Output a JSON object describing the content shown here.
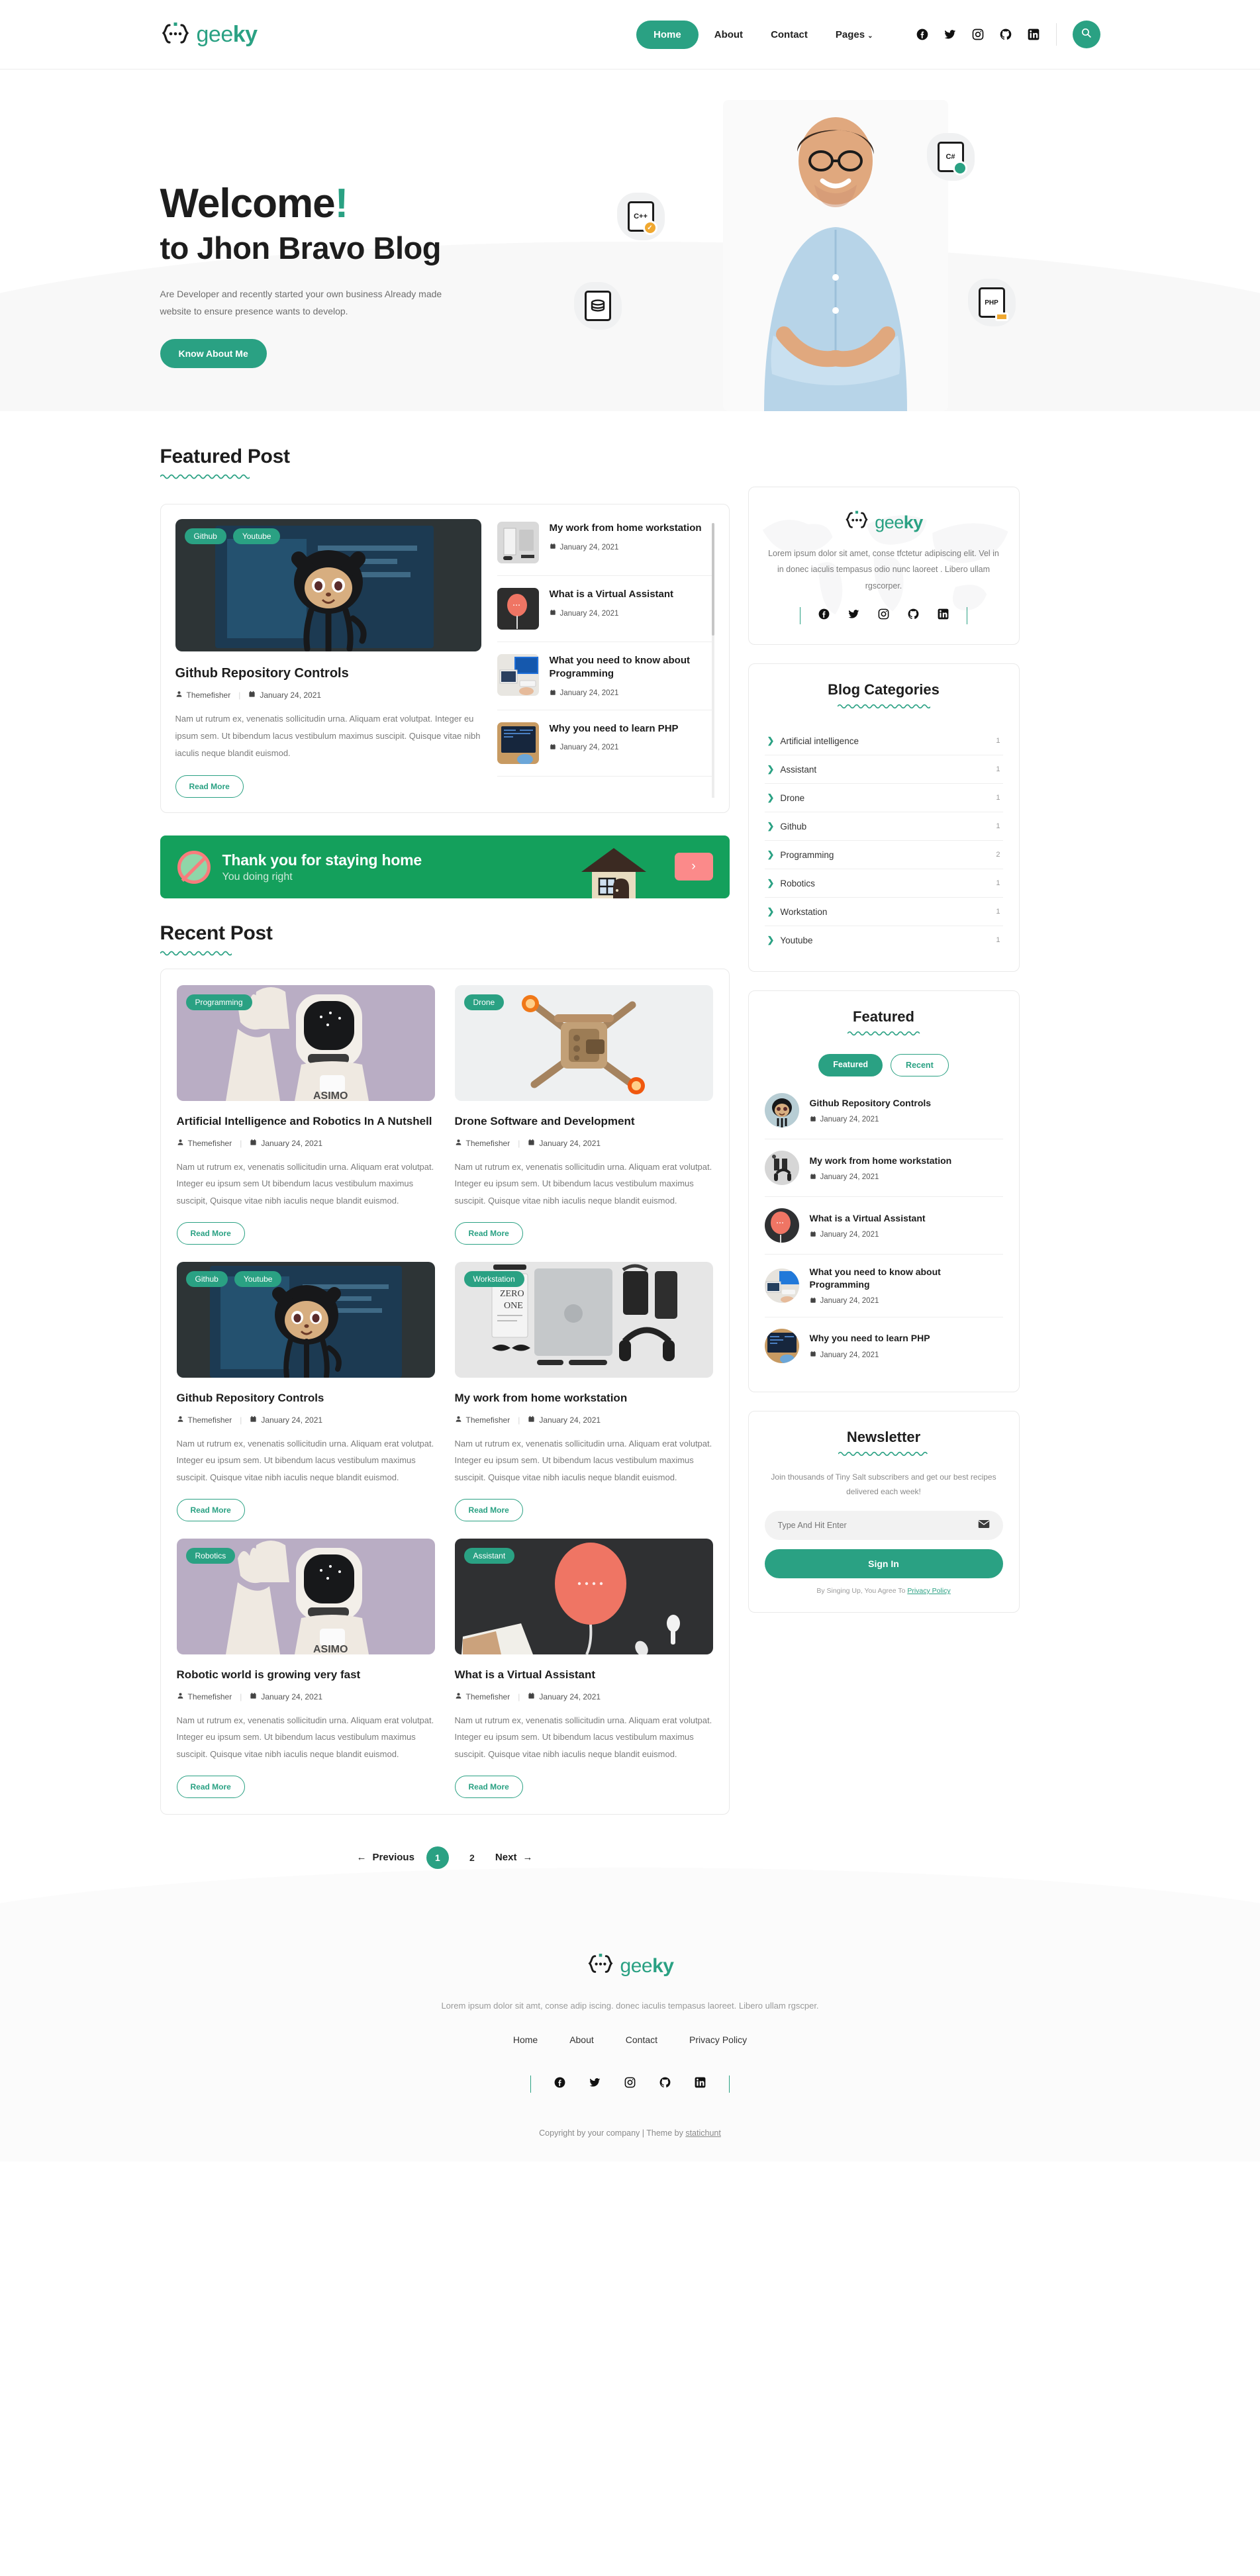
{
  "brand": {
    "name_light": "gee",
    "name_bold": "ky"
  },
  "header": {
    "nav": [
      {
        "label": "Home",
        "active": true
      },
      {
        "label": "About",
        "active": false
      },
      {
        "label": "Contact",
        "active": false
      },
      {
        "label": "Pages",
        "active": false,
        "caret": "⌄"
      }
    ],
    "socials": [
      "facebook-icon",
      "twitter-icon",
      "instagram-icon",
      "github-icon",
      "linkedin-icon"
    ],
    "search_label": "search-icon"
  },
  "hero": {
    "title": "Welcome",
    "bang": "!",
    "subtitle": "to Jhon Bravo Blog",
    "paragraph": "Are Developer and recently started your own business Already made website to ensure presence wants to develop.",
    "cta": "Know About Me",
    "floating_icons": [
      "C++",
      "C#",
      "DB",
      "PHP"
    ]
  },
  "featured_section": {
    "heading": "Featured Post",
    "main_post": {
      "tags": [
        "Github",
        "Youtube"
      ],
      "title": "Github Repository Controls",
      "author": "Themefisher",
      "date": "January 24, 2021",
      "excerpt": "Nam ut rutrum ex, venenatis sollicitudin urna. Aliquam erat volutpat. Integer eu ipsum sem. Ut bibendum lacus vestibulum maximus suscipit. Quisque vitae nibh iaculis neque blandit euismod.",
      "read_more": "Read More"
    },
    "list": [
      {
        "title": "My work from home workstation",
        "date": "January 24, 2021"
      },
      {
        "title": "What is a Virtual Assistant",
        "date": "January 24, 2021"
      },
      {
        "title": "What you need to know about Programming",
        "date": "January 24, 2021"
      },
      {
        "title": "Why you need to learn PHP",
        "date": "January 24, 2021"
      }
    ]
  },
  "promo": {
    "headline": "Thank you for staying home",
    "subline": "You doing right",
    "arrow": "›"
  },
  "recent_section": {
    "heading": "Recent Post",
    "posts": [
      {
        "tags": [
          "Programming"
        ],
        "title": "Artificial Intelligence and Robotics In A Nutshell",
        "author": "Themefisher",
        "date": "January 24, 2021",
        "excerpt": "Nam ut rutrum ex, venenatis sollicitudin urna. Aliquam erat volutpat. Integer eu ipsum sem Ut bibendum lacus vestibulum maximus suscipit, Quisque vitae nibh iaculis neque blandit euismod.",
        "read_more": "Read More"
      },
      {
        "tags": [
          "Drone"
        ],
        "title": "Drone Software and Development",
        "author": "Themefisher",
        "date": "January 24, 2021",
        "excerpt": "Nam ut rutrum ex, venenatis sollicitudin urna. Aliquam erat volutpat. Integer eu ipsum sem. Ut bibendum lacus vestibulum maximus suscipit. Quisque vitae nibh iaculis neque blandit euismod.",
        "read_more": "Read More"
      },
      {
        "tags": [
          "Github",
          "Youtube"
        ],
        "title": "Github Repository Controls",
        "author": "Themefisher",
        "date": "January 24, 2021",
        "excerpt": "Nam ut rutrum ex, venenatis sollicitudin urna. Aliquam erat volutpat. Integer eu ipsum sem. Ut bibendum lacus vestibulum maximus suscipit. Quisque vitae nibh iaculis neque blandit euismod.",
        "read_more": "Read More"
      },
      {
        "tags": [
          "Workstation"
        ],
        "title": "My work from home workstation",
        "author": "Themefisher",
        "date": "January 24, 2021",
        "excerpt": "Nam ut rutrum ex, venenatis sollicitudin urna. Aliquam erat volutpat. Integer eu ipsum sem. Ut bibendum lacus vestibulum maximus suscipit. Quisque vitae nibh iaculis neque blandit euismod.",
        "read_more": "Read More"
      },
      {
        "tags": [
          "Robotics"
        ],
        "title": "Robotic world is growing very fast",
        "author": "Themefisher",
        "date": "January 24, 2021",
        "excerpt": "Nam ut rutrum ex, venenatis sollicitudin urna. Aliquam erat volutpat. Integer eu ipsum sem. Ut bibendum lacus vestibulum maximus suscipit. Quisque vitae nibh iaculis neque blandit euismod.",
        "read_more": "Read More"
      },
      {
        "tags": [
          "Assistant"
        ],
        "title": "What is a Virtual Assistant",
        "author": "Themefisher",
        "date": "January 24, 2021",
        "excerpt": "Nam ut rutrum ex, venenatis sollicitudin urna. Aliquam erat volutpat. Integer eu ipsum sem. Ut bibendum lacus vestibulum maximus suscipit. Quisque vitae nibh iaculis neque blandit euismod.",
        "read_more": "Read More"
      }
    ]
  },
  "pagination": {
    "previous": "Previous",
    "next": "Next",
    "pages": [
      "1",
      "2"
    ],
    "current": "1",
    "prev_arrow": "←",
    "next_arrow": "→"
  },
  "sidebar": {
    "about": {
      "text": "Lorem ipsum dolor sit amet, conse tfctetur adipiscing elit. Vel in in donec iaculis tempasus odio nunc laoreet . Libero ullam rgscorper.",
      "socials": [
        "facebook-icon",
        "twitter-icon",
        "instagram-icon",
        "github-icon",
        "linkedin-icon"
      ]
    },
    "categories": {
      "title": "Blog Categories",
      "items": [
        {
          "name": "Artificial intelligence",
          "count": "1"
        },
        {
          "name": "Assistant",
          "count": "1"
        },
        {
          "name": "Drone",
          "count": "1"
        },
        {
          "name": "Github",
          "count": "1"
        },
        {
          "name": "Programming",
          "count": "2"
        },
        {
          "name": "Robotics",
          "count": "1"
        },
        {
          "name": "Workstation",
          "count": "1"
        },
        {
          "name": "Youtube",
          "count": "1"
        }
      ]
    },
    "featured": {
      "title": "Featured",
      "tabs": [
        {
          "label": "Featured",
          "active": true
        },
        {
          "label": "Recent",
          "active": false
        }
      ],
      "items": [
        {
          "title": "Github Repository Controls",
          "date": "January 24, 2021"
        },
        {
          "title": "My work from home workstation",
          "date": "January 24, 2021"
        },
        {
          "title": "What is a Virtual Assistant",
          "date": "January 24, 2021"
        },
        {
          "title": "What you need to know about Programming",
          "date": "January 24, 2021"
        },
        {
          "title": "Why you need to learn PHP",
          "date": "January 24, 2021"
        }
      ]
    },
    "newsletter": {
      "title": "Newsletter",
      "text": "Join thousands of Tiny Salt subscribers and get our best recipes delivered each week!",
      "placeholder": "Type And Hit Enter",
      "button": "Sign In",
      "note_prefix": "By Singing Up, You Agree To ",
      "note_link": "Privacy Policy"
    }
  },
  "footer": {
    "text": "Lorem ipsum dolor sit amt, conse adip iscing. donec iaculis tempasus laoreet. Libero ullam rgscper.",
    "nav": [
      "Home",
      "About",
      "Contact",
      "Privacy Policy"
    ],
    "socials": [
      "facebook-icon",
      "twitter-icon",
      "instagram-icon",
      "github-icon",
      "linkedin-icon"
    ],
    "copyright_prefix": "Copyright by your company | Theme by ",
    "copyright_link": "statichunt"
  },
  "colors": {
    "accent": "#2aa183",
    "promo_green": "#14a05c",
    "promo_pink": "#fb8a8a"
  }
}
